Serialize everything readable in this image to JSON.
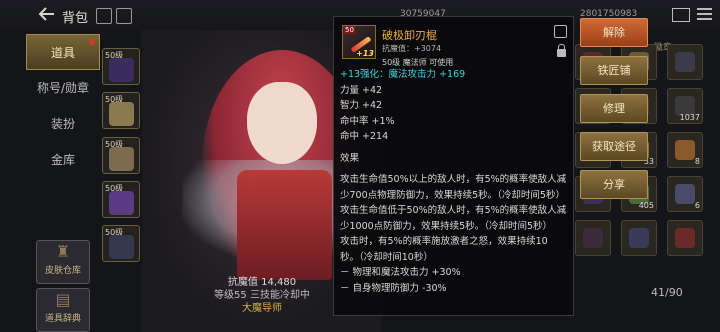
{
  "topbar": {
    "title": "背包",
    "currency1": "3075‍9047",
    "currency2": "2801750983"
  },
  "sidebar": {
    "items": [
      {
        "label": "道具",
        "active": true
      },
      {
        "label": "称号/勋章",
        "active": false
      },
      {
        "label": "装扮",
        "active": false
      },
      {
        "label": "金库",
        "active": false
      }
    ],
    "btn_wardrobe": "皮肤仓库",
    "btn_dictionary": "道具辞典"
  },
  "slots": [
    {
      "level": "50级",
      "icon": "shield-icon",
      "color": "#3c2b5e"
    },
    {
      "level": "50级",
      "icon": "book-icon",
      "color": "#8a7a4e"
    },
    {
      "level": "50级",
      "icon": "gauntlet-icon",
      "color": "#7d6b4f"
    },
    {
      "level": "50级",
      "icon": "belt-icon",
      "color": "#5a3a82"
    },
    {
      "level": "50级",
      "icon": "boot-icon",
      "color": "#33384f"
    }
  ],
  "character": {
    "resist_label": "抗魔值",
    "resist_value": "14,480",
    "info_line": "等级55 三技能冷却中",
    "class_name": "大魔导师"
  },
  "tooltip": {
    "item_level_tag": "50",
    "item_plus": "+13",
    "item_name": "破极卸刃棍",
    "resist": "抗魔值：+3074",
    "usable": "50级 魔法师 可使用",
    "enhance": "+13强化：魔法攻击力 +169",
    "stats": [
      "力量 +42",
      "智力 +42",
      "命中率 +1%",
      "命中 +214"
    ],
    "effect_title": "效果",
    "effect_lines": [
      "攻击生命值50%以上的敌人时，有5%的概率使敌人减",
      "少700点物理防御力，效果持续5秒。（冷却时间5秒）",
      "攻击生命值低于50%的敌人时，有5%的概率使敌人减",
      "少1000点防御力，效果持续5秒。（冷却时间5秒）",
      "攻击时，有5%的概率施放激者之怒，效果持续10",
      "秒。（冷却时间10秒）",
      "－ 物理和魔法攻击力 +30%",
      "－ 自身物理防御力 -30%"
    ]
  },
  "actions": [
    "解除",
    "铁匠铺",
    "修理",
    "获取途径",
    "分享"
  ],
  "inventory": {
    "header": "徽章",
    "cells": [
      {
        "count": "",
        "color": "#5a2a2a"
      },
      {
        "count": "",
        "color": "#6a5a3a"
      },
      {
        "count": "",
        "color": "#3a3a4a"
      },
      {
        "count": "",
        "color": "#5b4a2a"
      },
      {
        "count": "",
        "color": "#4a3a2a"
      },
      {
        "count": "1037",
        "color": "#3a3a3a"
      },
      {
        "count": "",
        "color": "#3b2f68"
      },
      {
        "count": "53",
        "color": "#8a6a2a"
      },
      {
        "count": "8",
        "color": "#8a5a2a"
      },
      {
        "count": "",
        "color": "#3a2f5a"
      },
      {
        "count": "405",
        "color": "#4a6a3a"
      },
      {
        "count": "6",
        "color": "#4a4a6a"
      },
      {
        "count": "",
        "color": "#3a2a3a"
      },
      {
        "count": "",
        "color": "#3a3a5a"
      },
      {
        "count": "",
        "color": "#6a2a2a"
      }
    ],
    "capacity": "41/90"
  }
}
